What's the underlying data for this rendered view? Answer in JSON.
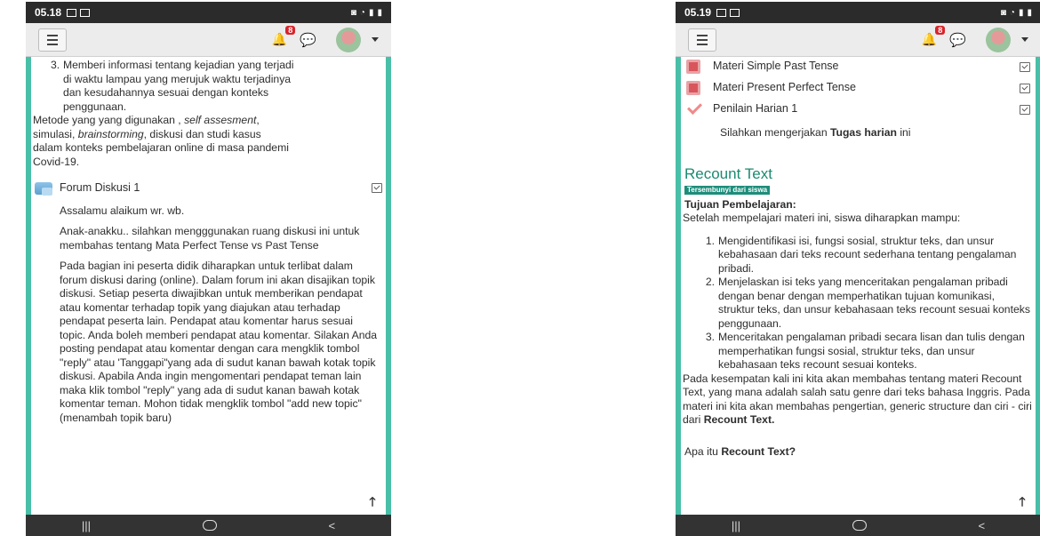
{
  "left": {
    "status": {
      "time": "05.18"
    },
    "top_nav": {
      "notification_count": "8"
    },
    "list_item3": {
      "number": "3.",
      "lines": [
        "Memberi informasi tentang kejadian yang terjadi",
        "di waktu lampau yang merujuk waktu terjadinya",
        "dan kesudahannya sesuai dengan konteks",
        "penggunaan."
      ]
    },
    "method_text": {
      "p1": "Metode yang yang digunakan , ",
      "p1_em": "self assesment",
      "p2": ",",
      "p3": "simulasi, ",
      "p3_em": "brainstorming",
      "p4": ",  diskusi dan studi kasus",
      "line3": "dalam konteks pembelajaran online di masa pandemi",
      "line4": "Covid-19."
    },
    "forum": {
      "title": "Forum Diskusi 1",
      "p1": "Assalamu alaikum wr. wb.",
      "p2": "Anak-anakku.. silahkan mengggunakan ruang diskusi ini untuk membahas tentang Mata Perfect Tense vs Past Tense",
      "p3": "Pada bagian ini peserta didik diharapkan untuk terlibat dalam forum diskusi daring (online). Dalam forum ini akan disajikan topik diskusi. Setiap peserta diwajibkan untuk memberikan pendapat atau komentar terhadap topik yang diajukan atau terhadap pendapat peserta lain. Pendapat atau komentar harus sesuai topic. Anda boleh memberi pendapat atau komentar. Silakan Anda posting pendapat atau komentar dengan cara mengklik tombol \"reply\" atau 'Tanggapi\"yang ada di sudut kanan bawah kotak topik diskusi. Apabila Anda ingin mengomentari pendapat teman lain maka klik tombol \"reply\" yang ada di sudut kanan bawah kotak komentar teman. Mohon tidak mengklik tombol \"add new topic\" (menambah topik baru)"
    }
  },
  "right": {
    "status": {
      "time": "05.19"
    },
    "top_nav": {
      "notification_count": "8"
    },
    "activities": [
      {
        "title": "Materi Simple Past Tense"
      },
      {
        "title": "Materi Present Perfect Tense"
      },
      {
        "title": "Penilain Harian 1"
      }
    ],
    "assignment_desc": {
      "prefix": "Silahkan mengerjakan ",
      "bold": "Tugas harian",
      "suffix": " ini"
    },
    "section": {
      "title": "Recount Text",
      "hidden_badge": "Tersembunyi dari siswa",
      "tujuan_label": "Tujuan Pembelajaran:",
      "intro": "Setelah mempelajari materi ini, siswa diharapkan mampu:",
      "objectives": [
        {
          "n": "1.",
          "text": "Mengidentifikasi isi, fungsi sosial, struktur teks, dan unsur kebahasaan dari teks recount sederhana tentang pengalaman pribadi."
        },
        {
          "n": "2.",
          "text": "Menjelaskan isi teks yang menceritakan pengalaman pribadi dengan benar dengan memperhatikan tujuan komunikasi, struktur teks, dan unsur kebahasaan teks recount sesuai konteks penggunaan."
        },
        {
          "n": "3.",
          "text": "Menceritakan pengalaman pribadi secara lisan dan tulis dengan memperhatikan fungsi sosial, struktur teks, dan unsur kebahasaan teks recount sesuai konteks."
        }
      ],
      "closing_text": "Pada kesempatan kali ini kita akan membahas tentang materi Recount Text, yang mana adalah salah satu genre dari teks bahasa Inggris. Pada materi ini kita akan membahas pengertian, generic structure dan ciri - ciri dari ",
      "closing_bold": "Recount Text.",
      "question_prefix": "Apa itu ",
      "question_bold": "Recount Text?"
    }
  },
  "colors": {
    "page_bg": "#49bfa8",
    "accent": "#1b8a72",
    "badge_red": "#d9232a"
  }
}
